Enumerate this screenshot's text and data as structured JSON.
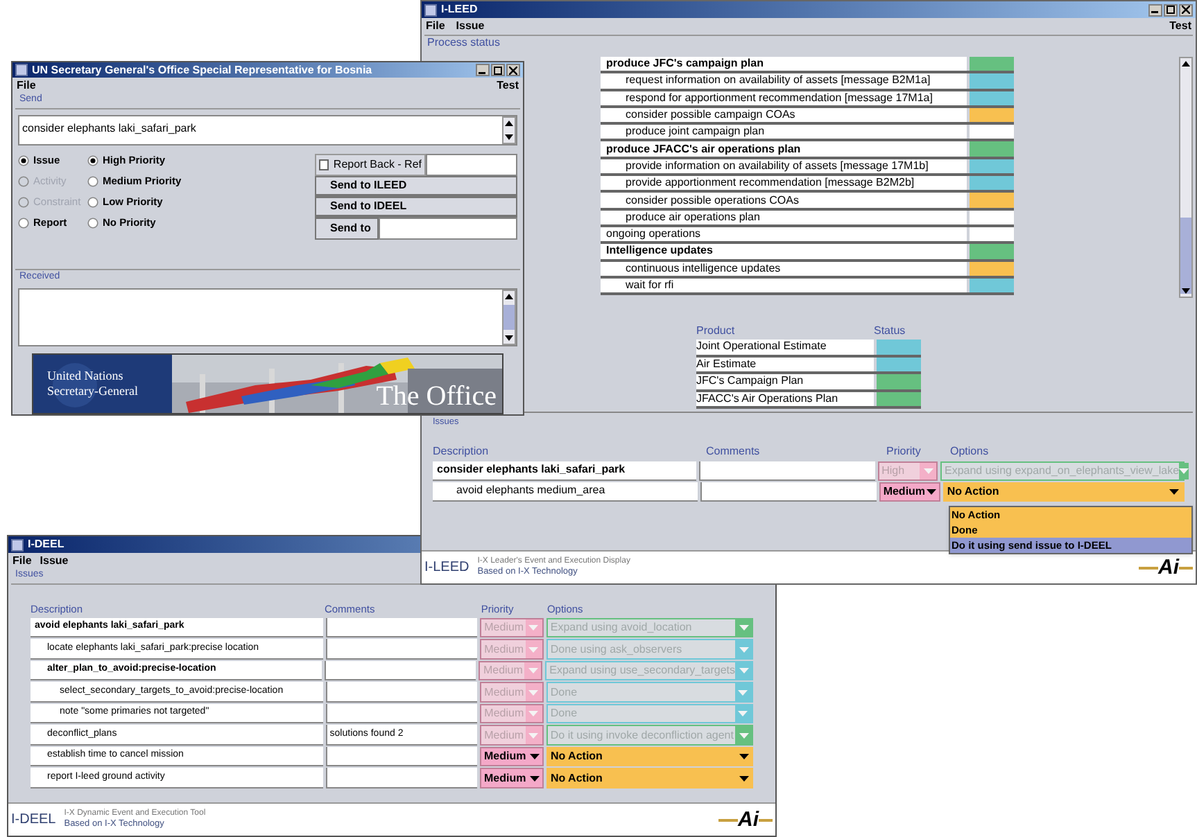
{
  "ileed": {
    "title": "I-LEED",
    "menu": [
      "File",
      "Issue"
    ],
    "menu_right": "Test",
    "process_label": "Process status",
    "process": [
      {
        "text": "produce JFC's campaign plan",
        "bold": true,
        "color": "#66c080",
        "children": [
          {
            "text": "request information on availability of assets [message B2M1a]",
            "bold": false,
            "color": "#70c8d8"
          },
          {
            "text": "respond for apportionment recommendation [message 17M1a]",
            "bold": false,
            "color": "#70c8d8"
          },
          {
            "text": "consider possible campaign COAs",
            "bold": false,
            "color": "#f8c050"
          },
          {
            "text": "produce joint campaign plan",
            "bold": false,
            "color": "#ffffff"
          }
        ]
      },
      {
        "text": "produce JFACC's air operations plan",
        "bold": true,
        "color": "#66c080",
        "children": [
          {
            "text": "provide information on availability of assets [message 17M1b]",
            "bold": false,
            "color": "#70c8d8"
          },
          {
            "text": "provide apportionment recommendation [message B2M2b]",
            "bold": false,
            "color": "#70c8d8"
          },
          {
            "text": "consider possible operations COAs",
            "bold": false,
            "color": "#f8c050"
          },
          {
            "text": "produce air operations plan",
            "bold": false,
            "color": "#ffffff"
          }
        ]
      },
      {
        "text": "ongoing operations",
        "bold": false,
        "color": "#ffffff"
      },
      {
        "text": "Intelligence updates",
        "bold": true,
        "color": "#66c080",
        "children": [
          {
            "text": "continuous intelligence updates",
            "bold": false,
            "color": "#f8c050"
          },
          {
            "text": "wait for rfi",
            "bold": false,
            "color": "#70c8d8"
          }
        ]
      }
    ],
    "product_header": "Product",
    "status_header": "Status",
    "products": [
      {
        "name": "Joint Operational Estimate",
        "color": "#70c8d8"
      },
      {
        "name": "Air Estimate",
        "color": "#70c8d8"
      },
      {
        "name": "JFC's Campaign Plan",
        "color": "#66c080"
      },
      {
        "name": "JFACC's Air Operations Plan",
        "color": "#66c080"
      }
    ],
    "issues_label": "Issues",
    "columns": [
      "Description",
      "Comments",
      "Priority",
      "Options"
    ],
    "issues": [
      {
        "text": "consider elephants laki_safari_park",
        "bold": true,
        "priority": "High",
        "option": "Expand using expand_on_elephants_view_lake",
        "color": "#66c080",
        "enabled": false,
        "children": [
          {
            "text": "avoid elephants medium_area",
            "bold": false,
            "priority": "Medium",
            "option": "No Action",
            "color": "#f8c050",
            "enabled": true
          }
        ]
      }
    ],
    "dropdown": [
      {
        "label": "No Action",
        "selected": false
      },
      {
        "label": "Done",
        "selected": false
      },
      {
        "label": "Do it using send issue to I-DEEL",
        "selected": true
      }
    ],
    "footer_name": "I-LEED",
    "footer_line": "I-X Leader's Event and Execution Display",
    "footer_based": "Based on I-X Technology",
    "logo": "Ai"
  },
  "un": {
    "title": "UN Secretary General's Office Special Representative for Bosnia",
    "menu": "File",
    "menu_right": "Test",
    "send_label": "Send",
    "message": "consider elephants laki_safari_park",
    "types": [
      {
        "label": "Issue",
        "selected": true,
        "disabled": false
      },
      {
        "label": "Activity",
        "selected": false,
        "disabled": true
      },
      {
        "label": "Constraint",
        "selected": false,
        "disabled": true
      },
      {
        "label": "Report",
        "selected": false,
        "disabled": false
      }
    ],
    "priorities": [
      {
        "label": "High Priority",
        "selected": true
      },
      {
        "label": "Medium Priority",
        "selected": false
      },
      {
        "label": "Low Priority",
        "selected": false
      },
      {
        "label": "No Priority",
        "selected": false
      }
    ],
    "report_back": {
      "label": "Report Back - Ref",
      "checked": false
    },
    "send_buttons": [
      "Send to ILEED",
      "Send to IDEEL"
    ],
    "send_to": "Send to",
    "received_label": "Received",
    "banner_line1": "United Nations",
    "banner_line2": "Secretary-General",
    "banner_right": "The Office"
  },
  "ideel": {
    "title": "I-DEEL",
    "menu": [
      "File",
      "Issue"
    ],
    "issues_label": "Issues",
    "columns": [
      "Description",
      "Comments",
      "Priority",
      "Options"
    ],
    "issues": [
      {
        "text": "avoid elephants laki_safari_park",
        "bold": true,
        "priority": "Medium",
        "option": "Expand using avoid_location",
        "color": "#66c080",
        "enabled": false,
        "children": [
          {
            "text": "locate elephants laki_safari_park:precise location",
            "bold": false,
            "priority": "Medium",
            "option": "Done using ask_observers",
            "color": "#70c8d8",
            "enabled": false
          },
          {
            "text": "alter_plan_to_avoid:precise-location",
            "bold": true,
            "priority": "Medium",
            "option": "Expand using use_secondary_targets",
            "color": "#70c8d8",
            "enabled": false,
            "children": [
              {
                "text": "select_secondary_targets_to_avoid:precise-location",
                "bold": false,
                "priority": "Medium",
                "option": "Done",
                "color": "#70c8d8",
                "enabled": false
              },
              {
                "text": "note \"some primaries not targeted\"",
                "bold": false,
                "priority": "Medium",
                "option": "Done",
                "color": "#70c8d8",
                "enabled": false
              }
            ]
          },
          {
            "text": "deconflict_plans",
            "bold": false,
            "comment": "solutions found 2",
            "priority": "Medium",
            "option": "Do it using invoke deconfliction agent",
            "color": "#66c080",
            "enabled": false
          },
          {
            "text": "establish time to cancel mission",
            "bold": false,
            "priority": "Medium",
            "option": "No Action",
            "color": "#f8c050",
            "enabled": true
          },
          {
            "text": "report I-leed ground activity",
            "bold": false,
            "priority": "Medium",
            "option": "No Action",
            "color": "#f8c050",
            "enabled": true
          }
        ]
      }
    ],
    "footer_name": "I-DEEL",
    "footer_line": "I-X Dynamic Event and Execution Tool",
    "footer_based": "Based on I-X Technology",
    "logo": "Ai"
  }
}
